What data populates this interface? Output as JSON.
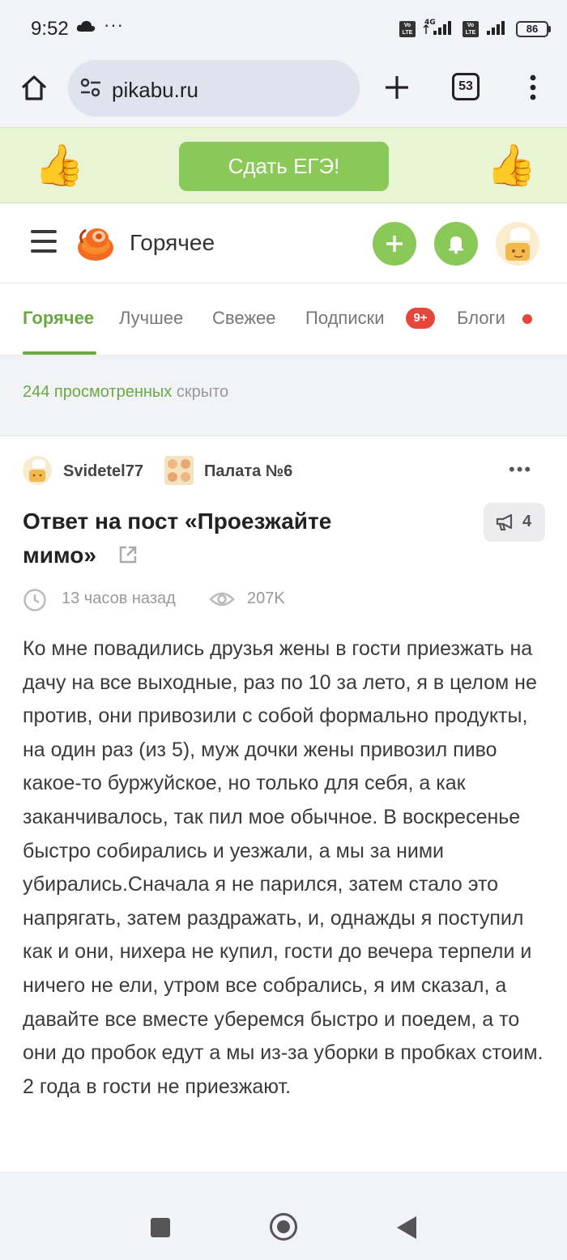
{
  "status_bar": {
    "time": "9:52",
    "dots": "···",
    "network": "4G",
    "battery": "86"
  },
  "browser": {
    "url": "pikabu.ru",
    "tab_count": "53"
  },
  "promo": {
    "button_label": "Сдать ЕГЭ!",
    "emoji": "👍"
  },
  "header": {
    "title": "Горячее"
  },
  "tabs": [
    {
      "label": "Горячее"
    },
    {
      "label": "Лучшее"
    },
    {
      "label": "Свежее"
    },
    {
      "label": "Подписки"
    },
    {
      "label": "Блоги"
    }
  ],
  "subscriptions_badge": "9+",
  "viewed": {
    "count_text": "244 просмотренных",
    "suffix": " скрыто"
  },
  "post": {
    "author": "Svidetel77",
    "community": "Палата №6",
    "title": "Ответ на пост «Проезжайте мимо»",
    "comments": "4",
    "time": "13 часов назад",
    "views": "207K",
    "body": "Ко мне повадились друзья жены в гости приезжать на дачу на все выходные, раз по 10 за лето, я в целом не против, они привозили с собой формально продукты, на один раз (из 5), муж дочки жены привозил пиво какое-то буржуйское, но только для себя, а как заканчивалось, так пил мое обычное. В воскресенье быстро собирались и уезжали, а мы за ними убирались.Сначала я не парился, затем стало это напрягать, затем раздражать, и, однажды я поступил как и они, нихера не купил, гости до вечера терпели и ничего не ели, утром все собрались, я им сказал, а давайте все вместе уберемся быстро и поедем, а то они до пробок едут а мы из-за уборки в пробках стоим. 2 года в гости не приезжают."
  },
  "colors": {
    "accent_green": "#8ac858",
    "active_tab_green": "#6aa843",
    "badge_red": "#e6463c",
    "promo_bg": "#e8f4d4",
    "logo_orange": "#f26b21"
  }
}
